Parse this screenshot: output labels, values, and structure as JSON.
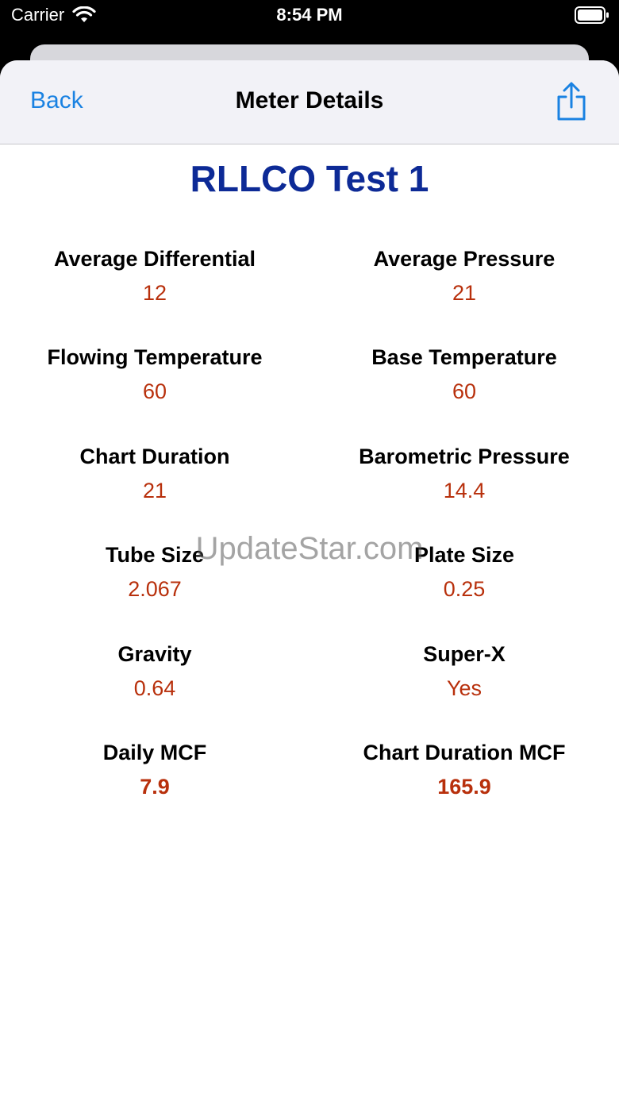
{
  "status_bar": {
    "carrier": "Carrier",
    "time": "8:54 PM"
  },
  "nav": {
    "back_label": "Back",
    "title": "Meter Details",
    "share_icon": "share-icon"
  },
  "meter": {
    "name": "RLLCO Test 1",
    "fields": [
      {
        "label": "Average Differential",
        "value": "12"
      },
      {
        "label": "Average Pressure",
        "value": "21"
      },
      {
        "label": "Flowing Temperature",
        "value": "60"
      },
      {
        "label": "Base Temperature",
        "value": "60"
      },
      {
        "label": "Chart Duration",
        "value": "21"
      },
      {
        "label": "Barometric Pressure",
        "value": "14.4"
      },
      {
        "label": "Tube Size",
        "value": "2.067"
      },
      {
        "label": "Plate Size",
        "value": "0.25"
      },
      {
        "label": "Gravity",
        "value": "0.64"
      },
      {
        "label": "Super-X",
        "value": "Yes"
      },
      {
        "label": "Daily MCF",
        "value": "7.9"
      },
      {
        "label": "Chart Duration MCF",
        "value": "165.9"
      }
    ]
  },
  "watermark": "UpdateStar.com",
  "colors": {
    "accent": "#1a82e2",
    "title": "#0d2a96",
    "value": "#b8300c"
  }
}
